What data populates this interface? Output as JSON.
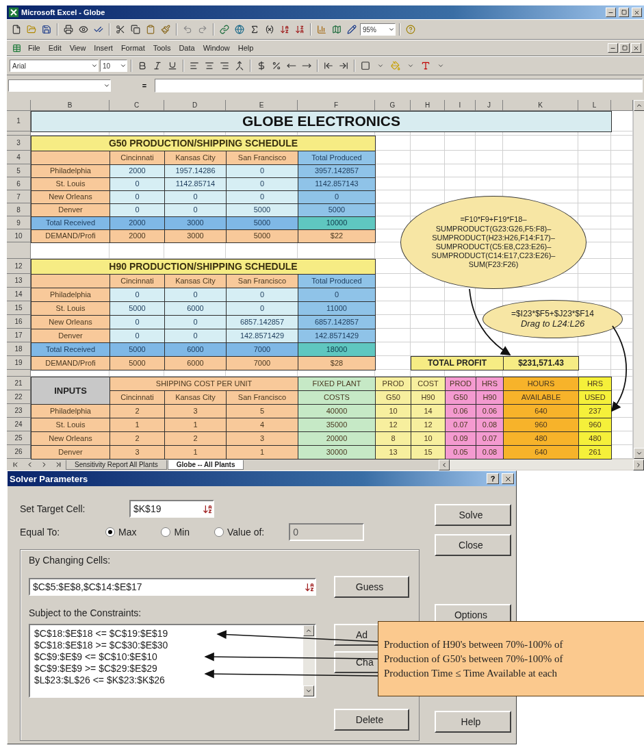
{
  "window": {
    "title": "Microsoft Excel - Globe"
  },
  "toolbar": {
    "zoom": "95%"
  },
  "menu": [
    "File",
    "Edit",
    "View",
    "Insert",
    "Format",
    "Tools",
    "Data",
    "Window",
    "Help"
  ],
  "format_toolbar": {
    "font": "Arial",
    "size": "10"
  },
  "formula_bar": {
    "equals": "="
  },
  "sheet": {
    "columns": [
      "B",
      "C",
      "D",
      "E",
      "F",
      "G",
      "H",
      "I",
      "J",
      "K",
      "L"
    ],
    "row_numbers": [
      "1",
      "3",
      "4",
      "5",
      "6",
      "7",
      "8",
      "9",
      "10",
      "12",
      "13",
      "14",
      "15",
      "16",
      "17",
      "18",
      "19",
      "21",
      "22",
      "23",
      "24",
      "25",
      "26"
    ],
    "title": "GLOBE ELECTRONICS",
    "schedules": [
      {
        "title": "G50 PRODUCTION/SHIPPING SCHEDULE",
        "headers": [
          "Cincinnati",
          "Kansas City",
          "San Francisco"
        ],
        "total_header": "Total Produced",
        "rows": [
          {
            "label": "Philadelphia",
            "values": [
              "2000",
              "1957.14286",
              "0"
            ],
            "total": "3957.142857"
          },
          {
            "label": "St. Louis",
            "values": [
              "0",
              "1142.85714",
              "0"
            ],
            "total": "1142.857143"
          },
          {
            "label": "New Orleans",
            "values": [
              "0",
              "0",
              "0"
            ],
            "total": "0"
          },
          {
            "label": "Denver",
            "values": [
              "0",
              "0",
              "5000"
            ],
            "total": "5000"
          }
        ],
        "received": {
          "label": "Total Received",
          "values": [
            "2000",
            "3000",
            "5000"
          ],
          "total": "10000"
        },
        "demand": {
          "label": "DEMAND/Profi",
          "values": [
            "2000",
            "3000",
            "5000"
          ],
          "total": "$22"
        }
      },
      {
        "title": "H90 PRODUCTION/SHIPPING SCHEDULE",
        "headers": [
          "Cincinnati",
          "Kansas City",
          "San Francisco"
        ],
        "total_header": "Total Produced",
        "rows": [
          {
            "label": "Philadelphia",
            "values": [
              "0",
              "0",
              "0"
            ],
            "total": "0"
          },
          {
            "label": "St. Louis",
            "values": [
              "5000",
              "6000",
              "0"
            ],
            "total": "11000"
          },
          {
            "label": "New Orleans",
            "values": [
              "0",
              "0",
              "6857.142857"
            ],
            "total": "6857.142857"
          },
          {
            "label": "Denver",
            "values": [
              "0",
              "0",
              "142.8571429"
            ],
            "total": "142.8571429"
          }
        ],
        "received": {
          "label": "Total Received",
          "values": [
            "5000",
            "6000",
            "7000"
          ],
          "total": "18000"
        },
        "demand": {
          "label": "DEMAND/Profi",
          "values": [
            "5000",
            "6000",
            "7000"
          ],
          "total": "$28"
        }
      }
    ],
    "total_profit": {
      "label": "TOTAL PROFIT",
      "value": "$231,571.43"
    },
    "inputs": {
      "title": "INPUTS",
      "shipping_title": "SHIPPING COST PER UNIT",
      "top": [
        {
          "text": "FIXED PLANT",
          "kind": "fixed"
        },
        {
          "text": "PROD",
          "kind": "cost"
        },
        {
          "text": "COST",
          "kind": "cost"
        },
        {
          "text": "PROD",
          "kind": "hours"
        },
        {
          "text": "HRS",
          "kind": "hours"
        },
        {
          "text": "HOURS",
          "kind": "available"
        },
        {
          "text": "HRS",
          "kind": "used"
        }
      ],
      "bottom": [
        {
          "text": "Cincinnati",
          "kind": "shipping"
        },
        {
          "text": "Kansas City",
          "kind": "shipping"
        },
        {
          "text": "San Francisco",
          "kind": "shipping"
        },
        {
          "text": "COSTS",
          "kind": "fixed"
        },
        {
          "text": "G50",
          "kind": "cost"
        },
        {
          "text": "H90",
          "kind": "cost"
        },
        {
          "text": "G50",
          "kind": "hours"
        },
        {
          "text": "H90",
          "kind": "hours"
        },
        {
          "text": "AVAILABLE",
          "kind": "available"
        },
        {
          "text": "USED",
          "kind": "used"
        }
      ],
      "rows": [
        {
          "label": "Philadelphia",
          "values": [
            "2",
            "3",
            "5",
            "40000",
            "10",
            "14",
            "0.06",
            "0.06",
            "640",
            "237"
          ]
        },
        {
          "label": "St. Louis",
          "values": [
            "1",
            "1",
            "4",
            "35000",
            "12",
            "12",
            "0.07",
            "0.08",
            "960",
            "960"
          ]
        },
        {
          "label": "New Orleans",
          "values": [
            "2",
            "2",
            "3",
            "20000",
            "8",
            "10",
            "0.09",
            "0.07",
            "480",
            "480"
          ]
        },
        {
          "label": "Denver",
          "values": [
            "3",
            "1",
            "1",
            "30000",
            "13",
            "15",
            "0.05",
            "0.08",
            "640",
            "261"
          ]
        }
      ]
    },
    "callouts": [
      {
        "lines": [
          "=F10*F9+F19*F18–",
          "SUMPRODUCT(G23:G26,F5:F8)–",
          "SUMPRODUCT(H23:H26,F14:F17)–",
          "SUMPRODUCT(C5:E8,C23:E26)–",
          "SUMPRODUCT(C14:E17,C23:E26)–",
          "SUM(F23:F26)"
        ]
      },
      {
        "lines": [
          "=$I23*$F5+$J23*$F14"
        ],
        "note": "Drag to L24:L26"
      }
    ]
  },
  "sheet_tabs": [
    {
      "label": "Sensitivity Report All Plants",
      "selected": false
    },
    {
      "label": "Globe -- All Plants",
      "selected": true
    }
  ],
  "solver": {
    "title": "Solver Parameters",
    "help": "?",
    "target_label": "Set Target Cell:",
    "target_value": "$K$19",
    "equal_label": "Equal To:",
    "options": [
      {
        "label": "Max",
        "selected": true
      },
      {
        "label": "Min",
        "selected": false
      },
      {
        "label": "Value of:",
        "selected": false
      }
    ],
    "value_field": {
      "value": "0",
      "disabled": true
    },
    "changing_label": "By Changing Cells:",
    "changing_value": "$C$5:$E$8,$C$14:$E$17",
    "guess": "Guess",
    "constraints_label": "Subject to the Constraints:",
    "constraints": [
      "$C$18:$E$18 <= $C$19:$E$19",
      "$C$18:$E$18 >= $C$30:$E$30",
      "$C$9:$E$9 <= $C$10:$E$10",
      "$C$9:$E$9 >= $C$29:$E$29",
      "$L$23:$L$26 <= $K$23:$K$26"
    ],
    "constraint_buttons": [
      "Ad",
      "Cha",
      "Delete"
    ],
    "side_buttons": [
      "Solve",
      "Close",
      "Options",
      "Help"
    ]
  },
  "annotation": {
    "lines": [
      "Production of H90's between 70%-100% of",
      "Production of G50's between 70%-100% of",
      "Production Time ≤ Time Available at each"
    ]
  }
}
